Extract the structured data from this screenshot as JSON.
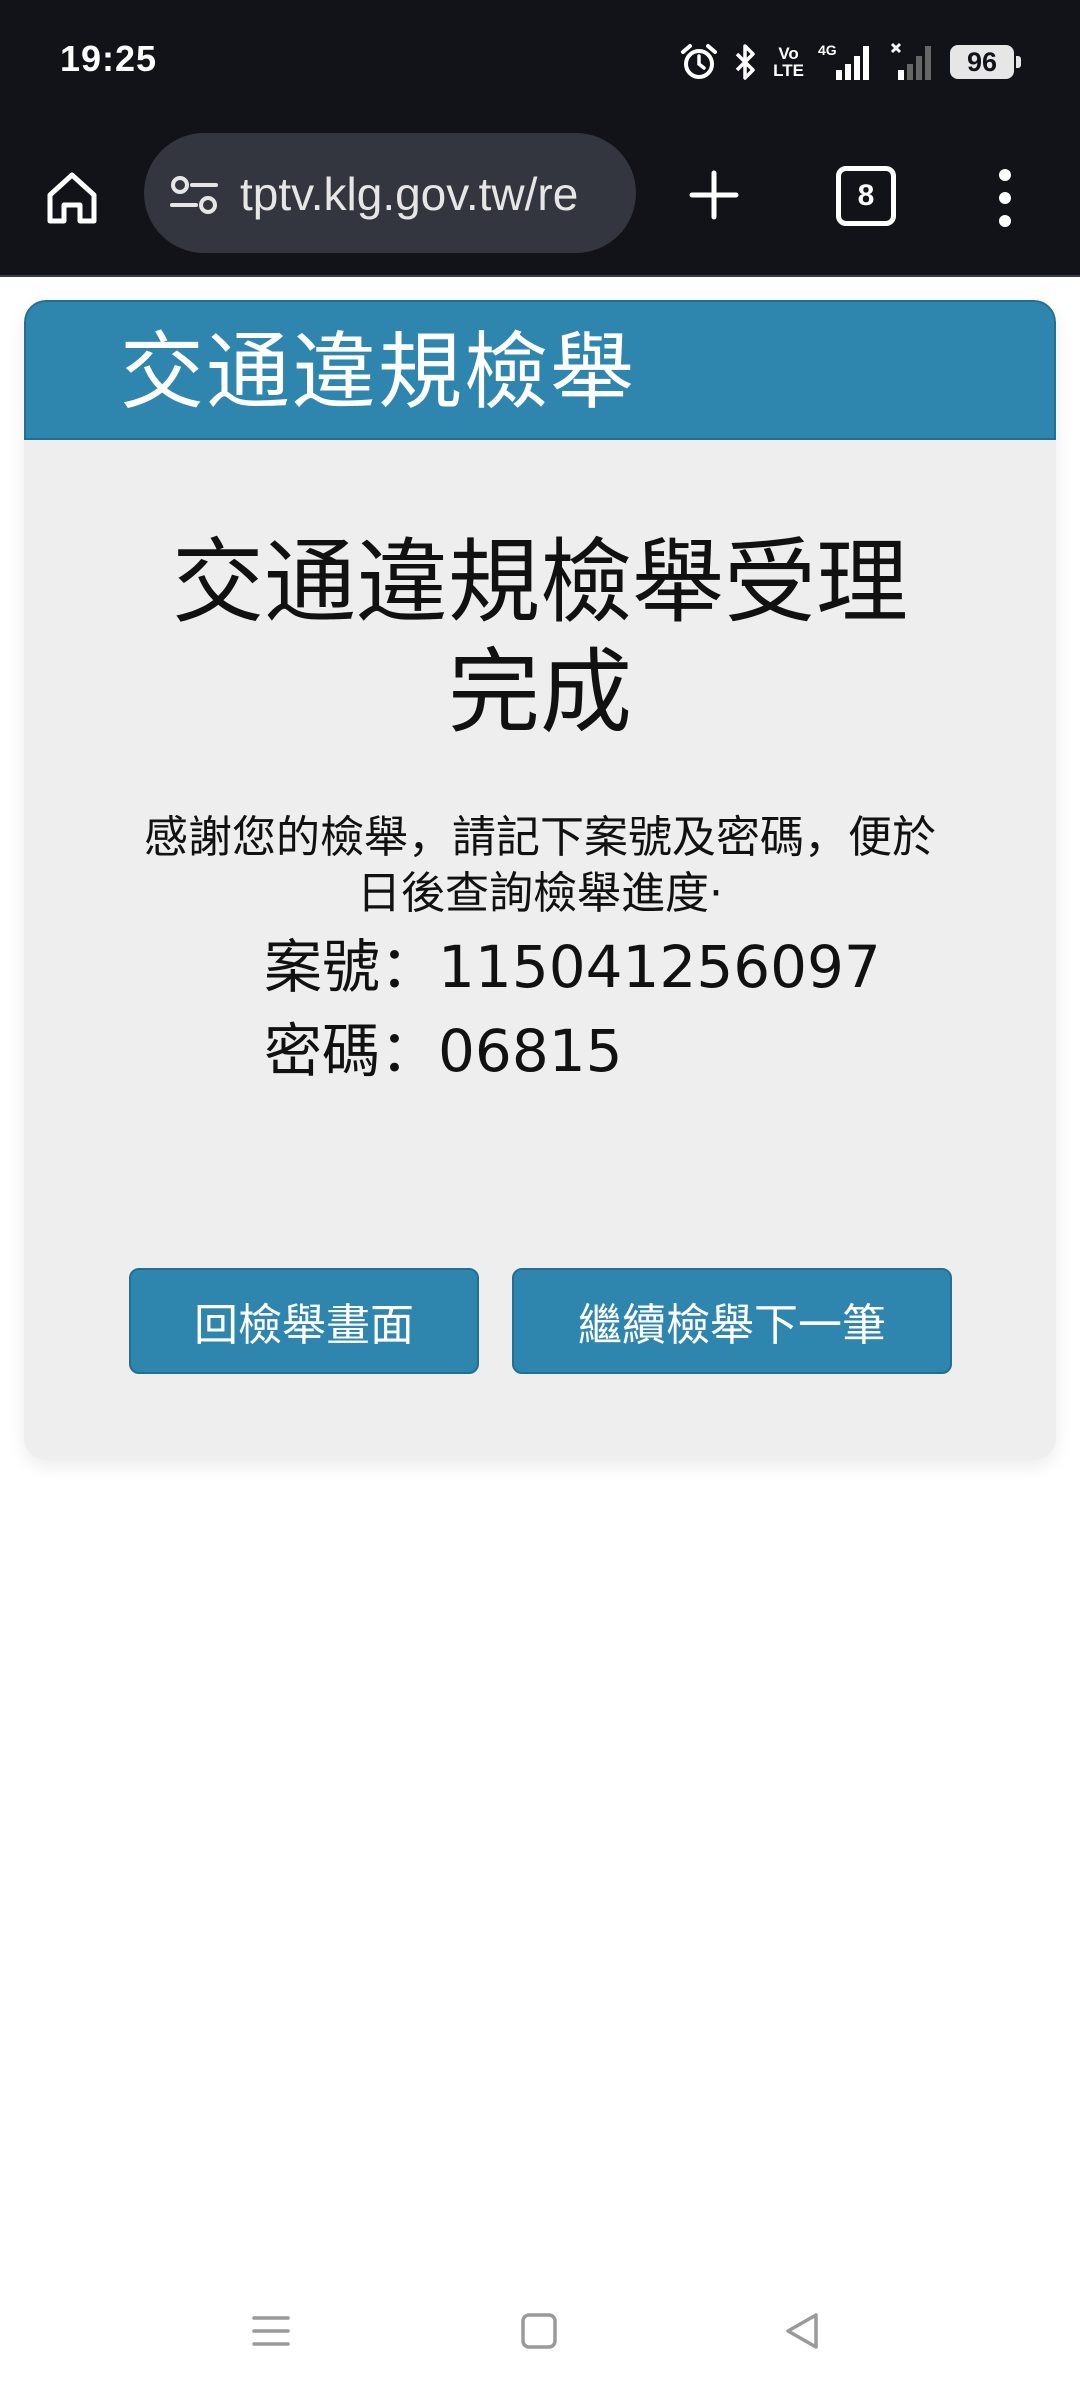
{
  "status_bar": {
    "time": "19:25",
    "volte_top": "Vo",
    "volte_bottom": "LTE",
    "network": "4G",
    "battery": "96"
  },
  "browser": {
    "url": "tptv.klg.gov.tw/re",
    "tab_count": "8"
  },
  "page": {
    "header_title": "交通違規檢舉",
    "result_title": "交通違規檢舉受理完成",
    "message": "感謝您的檢舉，請記下案號及密碼，便於日後查詢檢舉進度·",
    "case_label": "案號：",
    "case_number": "115041256097",
    "password_label": "密碼：",
    "password": "06815",
    "back_button": "回檢舉畫面",
    "next_button": "繼續檢舉下一筆"
  },
  "colors": {
    "accent": "#2e86ae",
    "status_bar_bg": "#121318"
  },
  "icons": {
    "home": "home-icon",
    "tune": "site-settings-icon",
    "plus": "new-tab-icon",
    "menu": "more-vert-icon",
    "alarm": "alarm-icon",
    "bluetooth": "bluetooth-icon",
    "signal": "signal-icon",
    "nav_menu": "recents-icon",
    "nav_home": "home-square-icon",
    "nav_back": "back-triangle-icon"
  }
}
